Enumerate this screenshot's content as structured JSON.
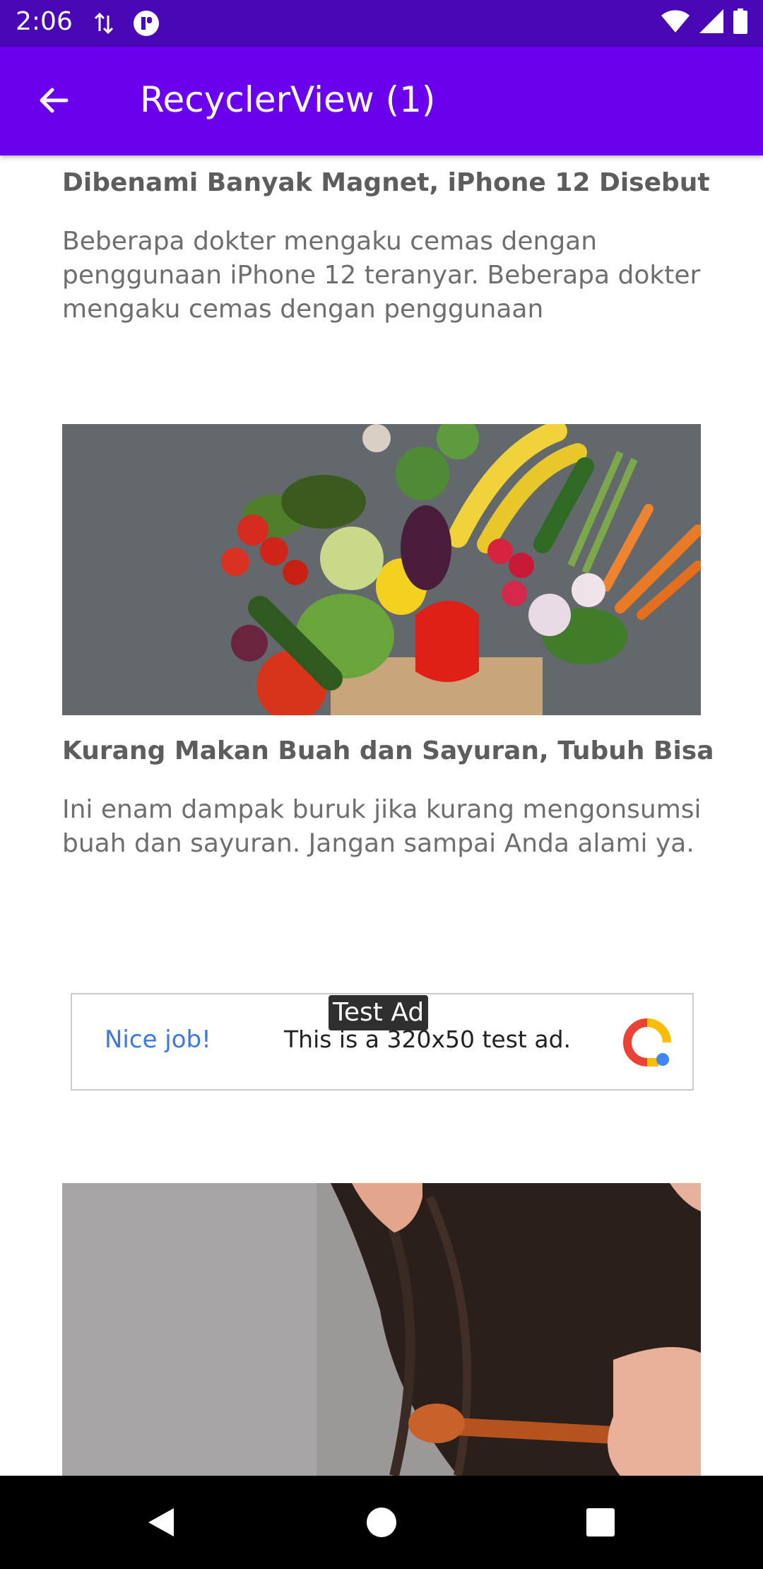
{
  "status_bar": {
    "time": "2:06"
  },
  "app_bar": {
    "title": "RecyclerView (1)"
  },
  "news_items": [
    {
      "title": "Dibenami Banyak Magnet, iPhone 12 Disebut",
      "description": "Beberapa dokter mengaku cemas dengan penggunaan iPhone 12 teranyar. Beberapa dokter mengaku cemas dengan penggunaan"
    },
    {
      "title": "Kurang Makan Buah dan Sayuran, Tubuh Bisa",
      "description": "Ini enam dampak buruk jika kurang mengonsumsi buah dan sayuran. Jangan sampai Anda alami ya."
    }
  ],
  "ad": {
    "badge": "Test Ad",
    "headline": "Nice job!",
    "text": "This is a 320x50 test ad."
  },
  "colors": {
    "status_bar": "#4a07b5",
    "app_bar": "#6a00ee",
    "nav_bar": "#000000"
  }
}
